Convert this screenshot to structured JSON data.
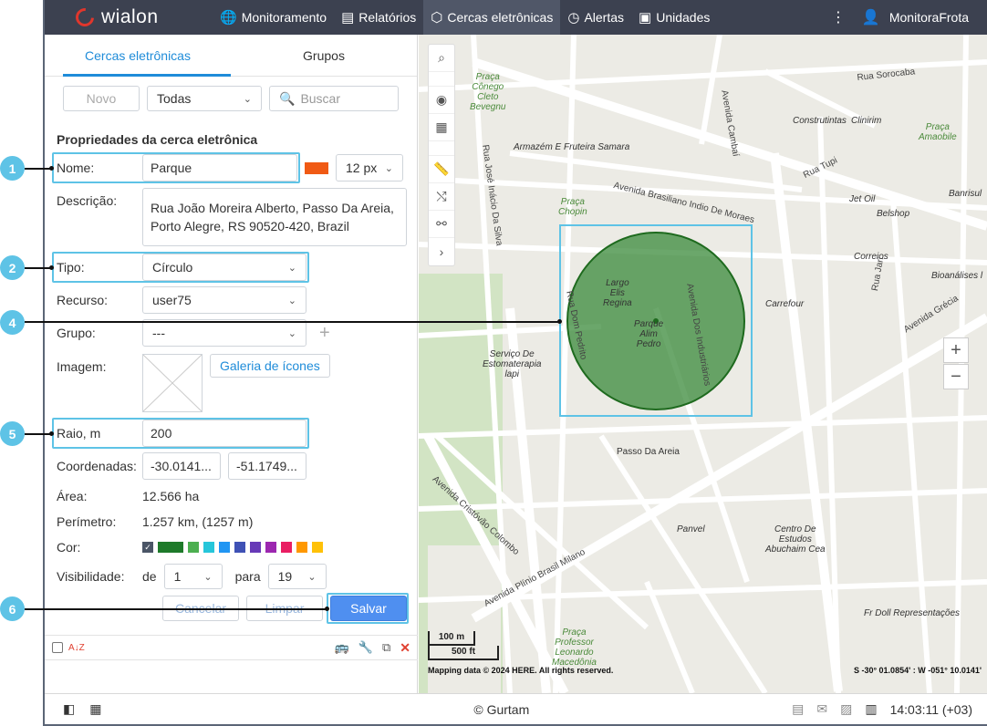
{
  "topbar": {
    "brand": "wialon",
    "nav": [
      {
        "label": "Monitoramento",
        "icon": "globe-icon"
      },
      {
        "label": "Relatórios",
        "icon": "chart-icon"
      },
      {
        "label": "Cercas eletrônicas",
        "icon": "geofence-icon"
      },
      {
        "label": "Alertas",
        "icon": "alarm-icon"
      },
      {
        "label": "Unidades",
        "icon": "bus-icon"
      }
    ],
    "user": "MonitoraFrota"
  },
  "panel": {
    "tabs": [
      "Cercas eletrônicas",
      "Grupos"
    ],
    "new_label": "Novo",
    "filter_value": "Todas",
    "search_placeholder": "Buscar",
    "section_title": "Propriedades da cerca eletrônica",
    "name_label": "Nome:",
    "name_value": "Parque",
    "line_width": "12 px",
    "desc_label": "Descrição:",
    "desc_line1": "Rua João Moreira Alberto, Passo Da Areia,",
    "desc_line2": "Porto Alegre, RS 90520-420, Brazil",
    "type_label": "Tipo:",
    "type_value": "Círculo",
    "resource_label": "Recurso:",
    "resource_value": "user75",
    "group_label": "Grupo:",
    "group_value": "---",
    "image_label": "Imagem:",
    "gallery_label": "Galeria de ícones",
    "radius_label": "Raio, m",
    "radius_value": "200",
    "coords_label": "Coordenadas:",
    "lat_value": "-30.0141...",
    "lon_value": "-51.1749...",
    "area_label": "Área:",
    "area_value": "12.566 ha",
    "perimeter_label": "Perímetro:",
    "perimeter_value": "1.257 km, (1257 m)",
    "color_label": "Cor:",
    "visibility_label": "Visibilidade:",
    "vis_from_label": "de",
    "vis_from": "1",
    "vis_to_label": "para",
    "vis_to": "19",
    "cancel_label": "Cancelar",
    "clear_label": "Limpar",
    "save_label": "Salvar",
    "sort_label": "A↓Z"
  },
  "colors": {
    "accent": "#1f8cd9",
    "selected_color": "#1e7a2a",
    "geofence_fill": "#3a8a3a",
    "palette": [
      "#1e7a2a",
      "#4caf50",
      "#26c6da",
      "#2196f3",
      "#3f51b5",
      "#673ab7",
      "#9c27b0",
      "#e91e63",
      "#ff9800",
      "#ffc107"
    ]
  },
  "map": {
    "labels": {
      "largo": "Largo\nElis\nRegina",
      "parque": "Parque\nAlim\nPedro",
      "passo": "Passo Da Areia",
      "armazem": "Armazém E Fruteira Samara",
      "carrefour": "Carrefour",
      "correios": "Correios",
      "jet_oil": "Jet Oil",
      "belshop": "Belshop",
      "panvel": "Panvel",
      "construtintas": "Construtintas",
      "clinirim": "Clinirim",
      "banrisul": "Banrisul",
      "bioanalises": "Bioanálises l",
      "servico": "Serviço De\nEstomaterapia\nlapi",
      "centro": "Centro De\nEstudos\nAbuchaim Cea",
      "fr_doll": "Fr Doll Representações",
      "praca_chopin": "Praça\nChopin",
      "praca_conego": "Praça\nCônego\nCleto\nBevegnu",
      "praca_amaobile": "Praça\nAmaobile",
      "praca_leonardo": "Praça\nProfessor\nLeonardo\nMacedônia",
      "av_brasiliano": "Avenida Brasiliano Indio De Moraes",
      "av_plinio": "Avenida Plínio Brasil Milano",
      "av_cristovao": "Avenida Cristóvão Colombo",
      "rua_dom_pedrito": "Rua Dom Pedrito",
      "av_industriarios": "Avenida Dos Industriários",
      "rua_sorocaba": "Rua Sorocaba",
      "av_cambai": "Avenida Cambaí",
      "rua_tupi": "Rua Tupi",
      "rua_jose_inacio": "Rua José Inácio Da Silva",
      "av_grecia": "Avenida Grécia",
      "rua_jari": "Rua Jari"
    },
    "scale_m": "100 m",
    "scale_ft": "500 ft",
    "attribution": "Mapping data © 2024 HERE. All rights reserved.",
    "coords": "S -30° 01.0854' : W -051° 10.0141'"
  },
  "footer": {
    "copyright": "© Gurtam",
    "time": "14:03:11 (+03)"
  },
  "callouts": [
    "1",
    "2",
    "4",
    "5",
    "6"
  ]
}
